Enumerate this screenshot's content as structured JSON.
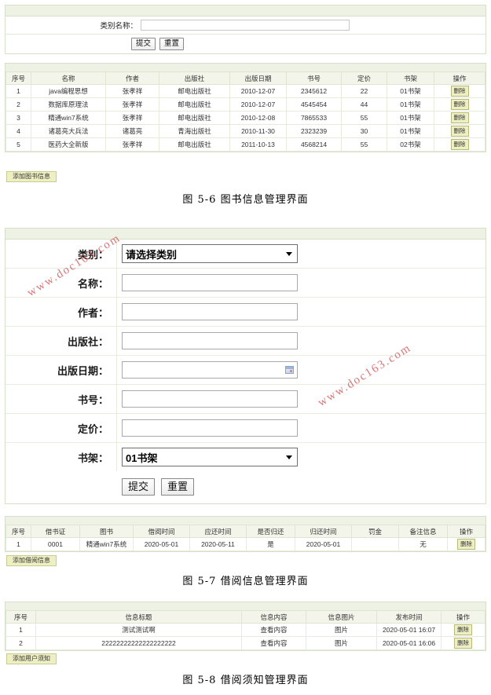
{
  "search_form": {
    "label": "类别名称：",
    "value": "",
    "placeholder": "",
    "submit_label": "提交",
    "reset_label": "重置"
  },
  "book_table": {
    "headers": [
      "序号",
      "名称",
      "作者",
      "出版社",
      "出版日期",
      "书号",
      "定价",
      "书架",
      "操作"
    ],
    "rows": [
      {
        "no": "1",
        "name": "java编程思想",
        "author": "张孝祥",
        "publisher": "邮电出版社",
        "pubdate": "2010-12-07",
        "isbn": "2345612",
        "price": "22",
        "shelf": "01书架",
        "action": "删除"
      },
      {
        "no": "2",
        "name": "数据库原理法",
        "author": "张孝祥",
        "publisher": "邮电出版社",
        "pubdate": "2010-12-07",
        "isbn": "4545454",
        "price": "44",
        "shelf": "01书架",
        "action": "删除"
      },
      {
        "no": "3",
        "name": "精通win7系统",
        "author": "张孝祥",
        "publisher": "邮电出版社",
        "pubdate": "2010-12-08",
        "isbn": "7865533",
        "price": "55",
        "shelf": "01书架",
        "action": "删除"
      },
      {
        "no": "4",
        "name": "诸葛亮大兵法",
        "author": "诸葛亮",
        "publisher": "青海出版社",
        "pubdate": "2010-11-30",
        "isbn": "2323239",
        "price": "30",
        "shelf": "01书架",
        "action": "删除"
      },
      {
        "no": "5",
        "name": "医药大全新版",
        "author": "张孝祥",
        "publisher": "邮电出版社",
        "pubdate": "2011-10-13",
        "isbn": "4568214",
        "price": "55",
        "shelf": "02书架",
        "action": "删除"
      }
    ],
    "add_label": "添加图书信息"
  },
  "caption_56": "图 5-6 图书信息管理界面",
  "book_form": {
    "rows": [
      {
        "label": "类别：",
        "type": "select",
        "value": "请选择类别"
      },
      {
        "label": "名称：",
        "type": "text",
        "value": ""
      },
      {
        "label": "作者：",
        "type": "text",
        "value": ""
      },
      {
        "label": "出版社：",
        "type": "text",
        "value": ""
      },
      {
        "label": "出版日期：",
        "type": "date",
        "value": ""
      },
      {
        "label": "书号：",
        "type": "text",
        "value": ""
      },
      {
        "label": "定价：",
        "type": "text",
        "value": ""
      },
      {
        "label": "书架：",
        "type": "select",
        "value": "01书架"
      }
    ],
    "submit_label": "提交",
    "reset_label": "重置"
  },
  "borrow_table": {
    "headers": [
      "序号",
      "借书证",
      "图书",
      "借阅时间",
      "应还时间",
      "是否归还",
      "归还时间",
      "罚金",
      "备注信息",
      "操作"
    ],
    "rows": [
      {
        "no": "1",
        "card": "0001",
        "book": "精通win7系统",
        "borrow_date": "2020-05-01",
        "due_date": "2020-05-11",
        "returned": "是",
        "return_date": "2020-05-01",
        "fine": "",
        "remark": "无",
        "action": "删除"
      }
    ],
    "add_label": "添加借阅信息"
  },
  "caption_57": "图 5-7 借阅信息管理界面",
  "notice_table": {
    "headers": [
      "序号",
      "信息标题",
      "信息内容",
      "信息图片",
      "发布时间",
      "操作"
    ],
    "rows": [
      {
        "no": "1",
        "title": "测试测试啊",
        "content": "查看内容",
        "image": "图片",
        "publish_time": "2020-05-01 16:07",
        "action": "删除"
      },
      {
        "no": "2",
        "title": "22222222222222222222",
        "content": "查看内容",
        "image": "图片",
        "publish_time": "2020-05-01 16:06",
        "action": "删除"
      }
    ],
    "add_label": "添加用户须知"
  },
  "caption_58": "图 5-8 借阅须知管理界面",
  "watermarks": [
    "www.doc163.com",
    "www.doc163.com"
  ],
  "colors": {
    "panel_border": "#d6dfc8",
    "panel_strip": "#eef2e4",
    "table_header": "#f3f5ea",
    "button_yellow": "#eef0c4",
    "watermark": "#d06060"
  }
}
